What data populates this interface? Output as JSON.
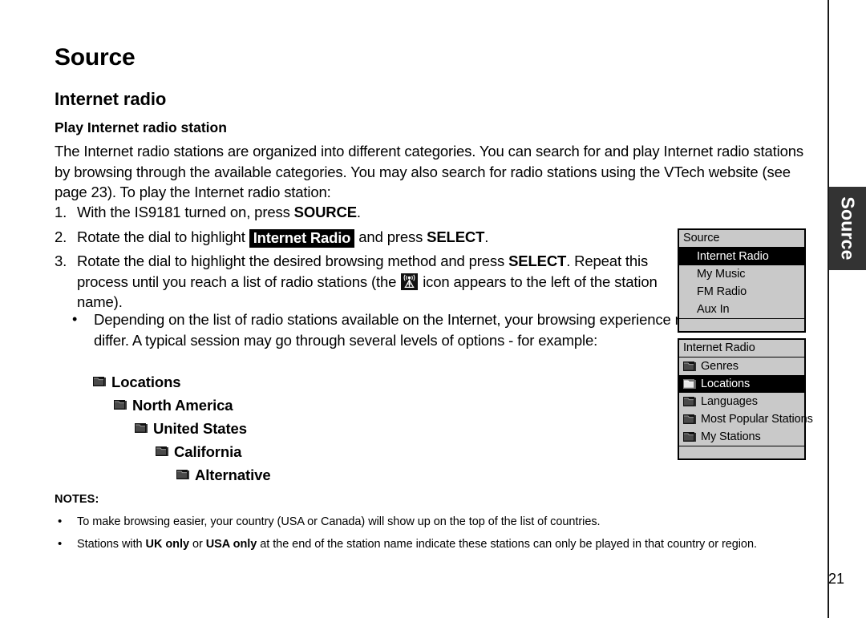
{
  "page": {
    "title": "Source",
    "section": "Internet radio",
    "subsection": "Play Internet radio station",
    "number": "21"
  },
  "side_tab": {
    "label": "Source",
    "background": "#333333",
    "text_color": "#ffffff"
  },
  "intro": "The Internet radio stations are organized into different categories. You can search for and play Internet radio stations by browsing through the available categories. You may also search for radio stations using the VTech website (see page 23). To play the Internet radio station:",
  "steps": [
    {
      "number": "1.",
      "parts": [
        {
          "type": "text",
          "text": "With the IS9181 turned on, press "
        },
        {
          "type": "bold",
          "text": "SOURCE"
        },
        {
          "type": "text",
          "text": "."
        }
      ]
    },
    {
      "number": "2.",
      "parts": [
        {
          "type": "text",
          "text": "Rotate the dial to highlight "
        },
        {
          "type": "chip",
          "text": "Internet Radio"
        },
        {
          "type": "text",
          "text": " and press "
        },
        {
          "type": "bold",
          "text": "SELECT"
        },
        {
          "type": "text",
          "text": "."
        }
      ]
    },
    {
      "number": "3.",
      "parts": [
        {
          "type": "text",
          "text": "Rotate the dial to highlight the desired browsing method and press "
        },
        {
          "type": "bold",
          "text": "SELECT"
        },
        {
          "type": "text",
          "text": ". Repeat this process until you reach a list of radio stations (the "
        },
        {
          "type": "icon",
          "icon": "antenna-icon"
        },
        {
          "type": "text",
          "text": " icon appears to the left of the station name)."
        }
      ]
    }
  ],
  "sub_bullet": {
    "marker": "•",
    "text": "Depending on the list of radio stations available on the Internet, your browsing experience may differ. A typical session may go through several levels of options - for example:"
  },
  "cascade": [
    {
      "label": "Locations",
      "icon": "folder-icon",
      "indent": 0
    },
    {
      "label": "North America",
      "icon": "folder-icon",
      "indent": 1
    },
    {
      "label": "United States",
      "icon": "folder-icon",
      "indent": 2
    },
    {
      "label": "California",
      "icon": "folder-icon",
      "indent": 3
    },
    {
      "label": "Alternative",
      "icon": "folder-icon",
      "indent": 4
    }
  ],
  "notes": {
    "heading": "NOTES:",
    "items": [
      {
        "marker": "•",
        "parts": [
          {
            "type": "text",
            "text": "To make browsing easier, your country (USA or Canada) will show up on the top of the list of countries."
          }
        ]
      },
      {
        "marker": "•",
        "parts": [
          {
            "type": "text",
            "text": "Stations with "
          },
          {
            "type": "bold",
            "text": "UK only"
          },
          {
            "type": "text",
            "text": " or "
          },
          {
            "type": "bold",
            "text": "USA only"
          },
          {
            "type": "text",
            "text": " at the end of the station name indicate these stations can only be played in that country or region."
          }
        ]
      }
    ]
  },
  "lcd_screens": [
    {
      "id": "source",
      "title": "Source",
      "rows": [
        {
          "label": "Internet Radio",
          "selected": true,
          "icon": null,
          "indent": true
        },
        {
          "label": "My Music",
          "selected": false,
          "icon": null,
          "indent": true
        },
        {
          "label": "FM Radio",
          "selected": false,
          "icon": null,
          "indent": true
        },
        {
          "label": "Aux In",
          "selected": false,
          "icon": null,
          "indent": true
        }
      ]
    },
    {
      "id": "internet-radio",
      "title": "Internet Radio",
      "rows": [
        {
          "label": "Genres",
          "selected": false,
          "icon": "folder-icon",
          "indent": false
        },
        {
          "label": "Locations",
          "selected": true,
          "icon": "folder-icon",
          "indent": false
        },
        {
          "label": "Languages",
          "selected": false,
          "icon": "folder-icon",
          "indent": false
        },
        {
          "label": "Most Popular Stations",
          "selected": false,
          "icon": "folder-icon",
          "indent": false
        },
        {
          "label": "My Stations",
          "selected": false,
          "icon": "folder-icon",
          "indent": false
        }
      ]
    }
  ],
  "colors": {
    "lcd_background": "#c9c9c9",
    "lcd_border": "#000000",
    "selection_background": "#000000",
    "selection_text": "#ffffff",
    "tab_background": "#333333",
    "page_text": "#000000"
  }
}
